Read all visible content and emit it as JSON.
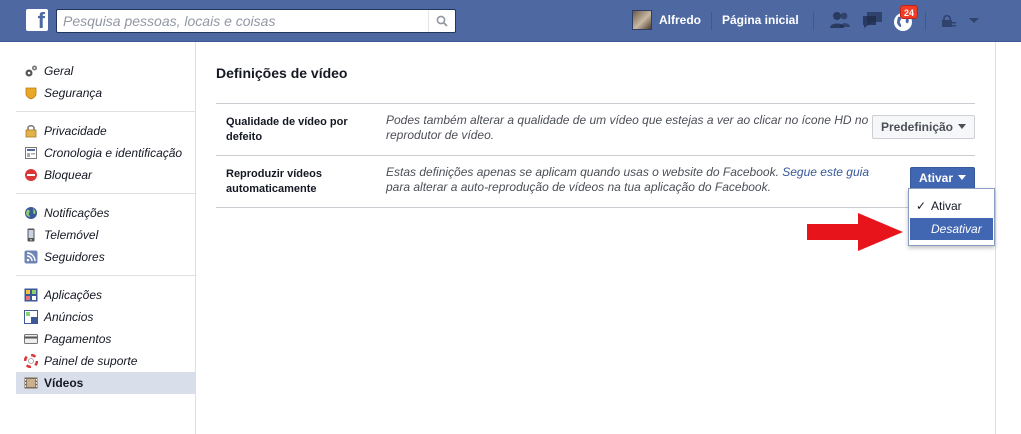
{
  "header": {
    "search_placeholder": "Pesquisa pessoas, locais e coisas",
    "user_name": "Alfredo",
    "home_label": "Página inicial",
    "notification_count": "24",
    "brand_color": "#4e69a2"
  },
  "sidebar": {
    "groups": [
      [
        {
          "label": "Geral",
          "icon": "gears-icon"
        },
        {
          "label": "Segurança",
          "icon": "shield-badge-icon"
        }
      ],
      [
        {
          "label": "Privacidade",
          "icon": "lock-icon"
        },
        {
          "label": "Cronologia e identificação",
          "icon": "timeline-icon"
        },
        {
          "label": "Bloquear",
          "icon": "block-icon"
        }
      ],
      [
        {
          "label": "Notificações",
          "icon": "globe-icon"
        },
        {
          "label": "Telemóvel",
          "icon": "mobile-icon"
        },
        {
          "label": "Seguidores",
          "icon": "rss-icon"
        }
      ],
      [
        {
          "label": "Aplicações",
          "icon": "apps-icon"
        },
        {
          "label": "Anúncios",
          "icon": "ads-icon"
        },
        {
          "label": "Pagamentos",
          "icon": "card-icon"
        },
        {
          "label": "Painel de suporte",
          "icon": "lifebuoy-icon"
        },
        {
          "label": "Vídeos",
          "icon": "film-icon",
          "active": true
        }
      ]
    ]
  },
  "main": {
    "title": "Definições de vídeo",
    "rows": [
      {
        "label": "Qualidade de vídeo por defeito",
        "description": "Podes também alterar a qualidade de um vídeo que estejas a ver ao clicar no ícone HD no reprodutor de vídeo.",
        "button": "Predefinição"
      },
      {
        "label": "Reproduzir vídeos automaticamente",
        "description_prefix": "Estas definições apenas se aplicam quando usas o website do Facebook. ",
        "description_link": "Segue este guia",
        "description_suffix": " para alterar a auto-reprodução de vídeos na tua aplicação do Facebook.",
        "button": "Ativar"
      }
    ]
  },
  "dropdown": {
    "options": [
      "Ativar",
      "Desativar"
    ],
    "selected": "Ativar",
    "highlighted": "Desativar"
  },
  "annotation": {
    "arrow_color": "#e8141b"
  }
}
